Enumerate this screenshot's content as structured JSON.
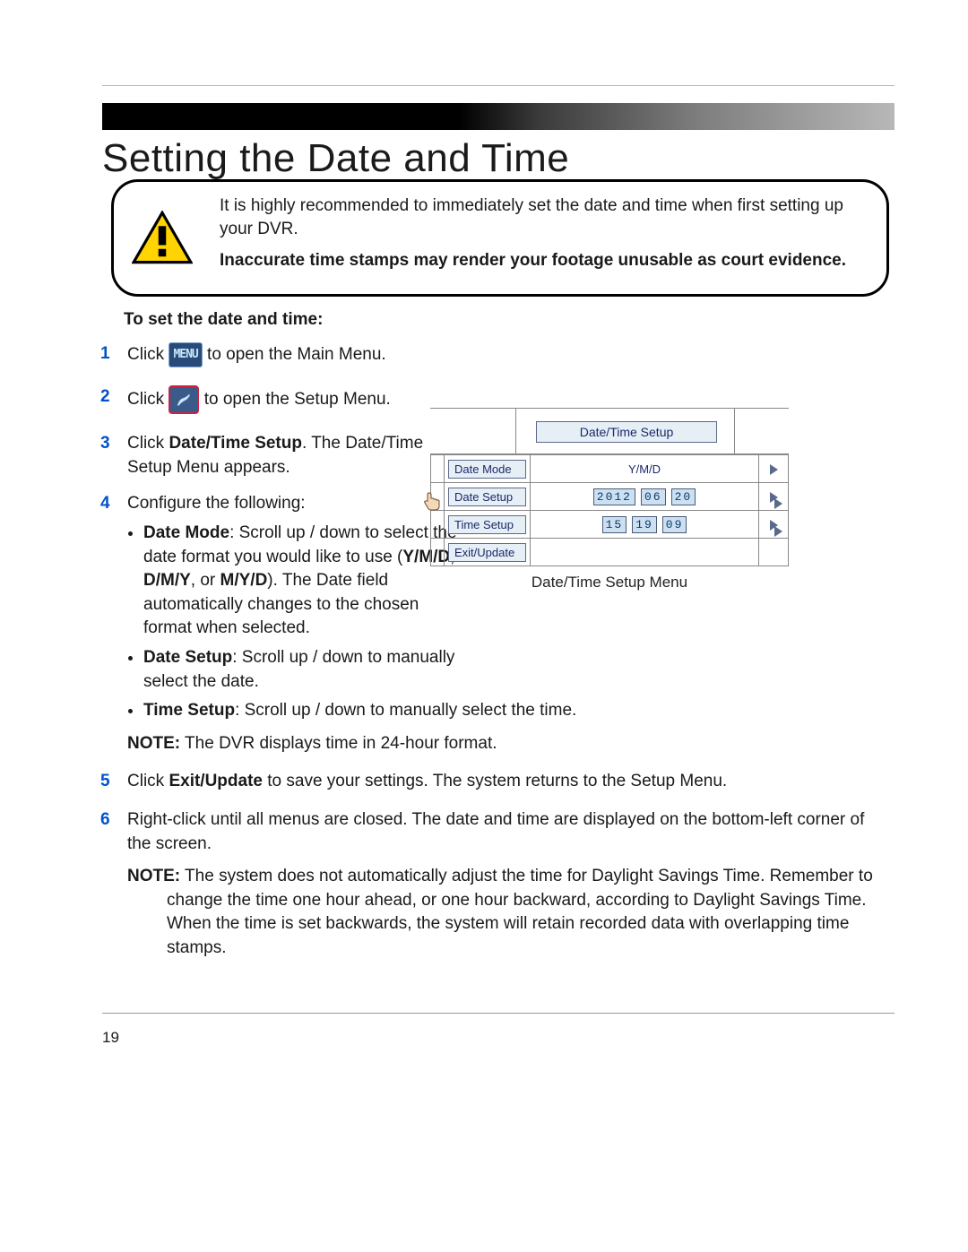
{
  "page": {
    "title": "Setting the Date and Time",
    "page_number": "19"
  },
  "callout": {
    "p1": "It is highly recommended to immediately set the date and time when first setting up your DVR.",
    "p2": "Inaccurate time stamps may render your footage unusable as court evidence."
  },
  "subhead": "To set the date and time:",
  "icons": {
    "menu_label": "MENU"
  },
  "steps": {
    "s1_a": "Click ",
    "s1_b": " to open the Main Menu.",
    "s2_a": "Click ",
    "s2_b": " to open the Setup Menu.",
    "s3_a": "Click ",
    "s3_bold": "Date/Time Setup",
    "s3_b": ". The Date/Time Setup Menu appears.",
    "s4": "Configure the following:",
    "s4_b1_label": "Date Mode",
    "s4_b1_a": ": Scroll up / down to select the date format you would like to use (",
    "s4_b1_opt1": "Y/M/D",
    "s4_b1_comma": ", ",
    "s4_b1_opt2": "D/M/Y",
    "s4_b1_or": ", or ",
    "s4_b1_opt3": "M/Y/D",
    "s4_b1_b": "). The Date field automatically changes to the chosen format when selected.",
    "s4_b2_label": "Date Setup",
    "s4_b2_text": ": Scroll up / down to manually select the date.",
    "s4_b3_label": "Time Setup",
    "s4_b3_text": ": Scroll up / down to manually select the time.",
    "s4_note_label": "NOTE:",
    "s4_note_text": " The DVR displays time in 24-hour format.",
    "s5_a": "Click ",
    "s5_bold": "Exit/Update",
    "s5_b": " to save your settings. The system returns to the Setup Menu.",
    "s6": "Right-click until all menus are closed. The date and time are displayed on the bottom-left corner of the screen.",
    "s6_note_label": "NOTE:",
    "s6_note_text": " The system does not automatically adjust the time for Daylight Savings Time. Remember to change the time one hour ahead, or one hour backward, according to Daylight Savings Time. When the time is set backwards, the system will retain recorded data with overlapping time stamps."
  },
  "figure": {
    "title": "Date/Time Setup",
    "rows": {
      "date_mode": "Date Mode",
      "date_setup": "Date Setup",
      "time_setup": "Time Setup",
      "exit": "Exit/Update"
    },
    "values": {
      "mode": "Y/M/D",
      "year": "2012",
      "month": "06",
      "day": "20",
      "hour": "15",
      "min": "19",
      "sec": "09"
    },
    "caption": "Date/Time Setup Menu"
  }
}
